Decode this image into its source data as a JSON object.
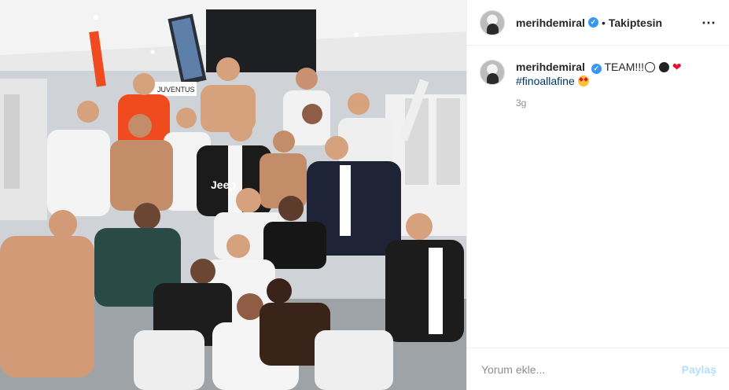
{
  "header": {
    "username": "merihdemiral",
    "verified_badge": "✓",
    "separator": "•",
    "follow_label": "Takiptesin",
    "more_icon": "⋯"
  },
  "caption": {
    "username": "merihdemiral",
    "verified_badge": "✓",
    "text": "TEAM!!!",
    "emojis": [
      "white-circle",
      "black-circle",
      "red-heart"
    ],
    "heart_glyph": "❤",
    "hashtag": "#finoallafine",
    "time": "3g"
  },
  "comment_box": {
    "placeholder": "Yorum ekle...",
    "post_label": "Paylaş"
  },
  "photo": {
    "banner_text": "JUVENTUS",
    "shirt_text": "Jeep"
  },
  "colors": {
    "verified": "#3897f0",
    "hashtag": "#003569",
    "post_disabled": "#b2dffc",
    "muted": "#8e8e8e"
  }
}
